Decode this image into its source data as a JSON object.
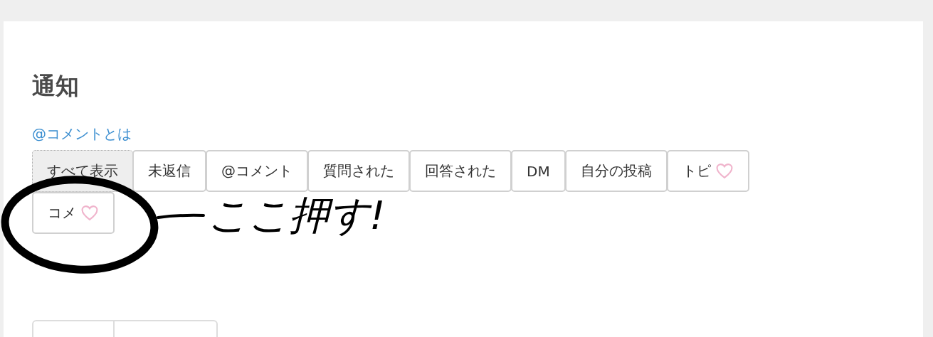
{
  "title": "通知",
  "help_link": "@コメントとは",
  "filter_tabs": [
    {
      "label": "すべて表示",
      "selected": true,
      "kind": "plain"
    },
    {
      "label": "未返信",
      "selected": false,
      "kind": "plain"
    },
    {
      "label": "@コメント",
      "selected": false,
      "kind": "plain"
    },
    {
      "label": "質問された",
      "selected": false,
      "kind": "plain"
    },
    {
      "label": "回答された",
      "selected": false,
      "kind": "plain"
    },
    {
      "label": "DM",
      "selected": false,
      "kind": "plain"
    },
    {
      "label": "自分の投稿",
      "selected": false,
      "kind": "plain"
    },
    {
      "label": "トピ",
      "selected": false,
      "kind": "liked"
    },
    {
      "label": "コメ",
      "selected": false,
      "kind": "liked"
    }
  ],
  "annotation": {
    "text": "ここ押す!"
  }
}
